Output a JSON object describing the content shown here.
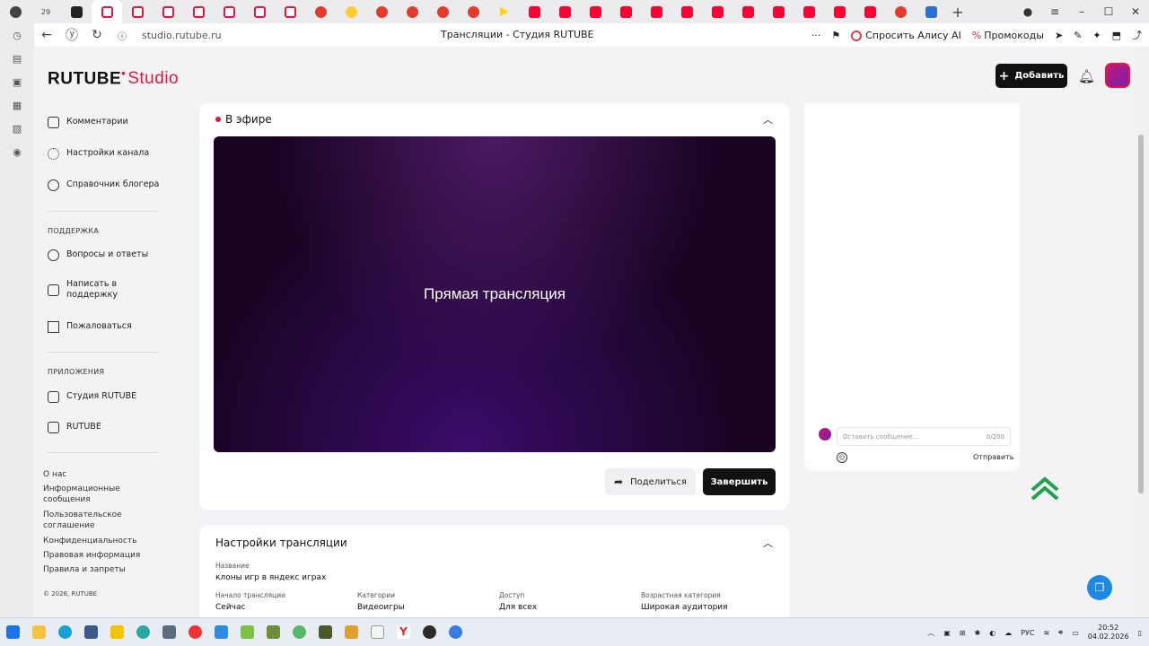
{
  "browser": {
    "tab_count_badge": "29",
    "url": "studio.rutube.ru",
    "page_title": "Трансляции - Студия RUTUBE",
    "menu_dots": "···",
    "alice_label": "Спросить Алису AI",
    "promo_label": "Промокоды"
  },
  "header": {
    "logo_main": "RUTUBE",
    "logo_studio": "Studio",
    "add_button": "Добавить"
  },
  "sidebar": {
    "items": [
      {
        "label": "Комментарии"
      },
      {
        "label": "Настройки канала"
      },
      {
        "label": "Справочник блогера"
      }
    ],
    "support_heading": "ПОДДЕРЖКА",
    "support_items": [
      {
        "label": "Вопросы и ответы"
      },
      {
        "label": "Написать в поддержку"
      },
      {
        "label": "Пожаловаться"
      }
    ],
    "apps_heading": "ПРИЛОЖЕНИЯ",
    "apps_items": [
      {
        "label": "Студия RUTUBE"
      },
      {
        "label": "RUTUBE"
      }
    ],
    "footer_links": [
      "О нас",
      "Информационные сообщения",
      "Пользовательское соглашение",
      "Конфиденциальность",
      "Правовая информация",
      "Правила и запреты"
    ],
    "copyright": "© 2026, RUTUBE"
  },
  "live": {
    "status": "В эфире",
    "video_label": "Прямая трансляция",
    "share_button": "Поделиться",
    "end_button": "Завершить"
  },
  "settings": {
    "title": "Настройки трансляции",
    "name_label": "Название",
    "name_value": "клоны игр в яндекс играх",
    "fields": [
      {
        "label": "Начало трансляции",
        "value": "Сейчас"
      },
      {
        "label": "Категории",
        "value": "Видеоигры"
      },
      {
        "label": "Доступ",
        "value": "Для всех"
      },
      {
        "label": "Возрастная категория",
        "value": "Широкая аудитория"
      }
    ]
  },
  "chat": {
    "placeholder": "Оставить сообщение...",
    "counter": "0/200",
    "send_button": "Отправить"
  },
  "taskbar": {
    "lang": "РУС",
    "time": "20:52",
    "date": "04.02.2026"
  },
  "colors": {
    "accent": "#e4173d",
    "dark_button": "#111111",
    "fab": "#1e88e5"
  }
}
